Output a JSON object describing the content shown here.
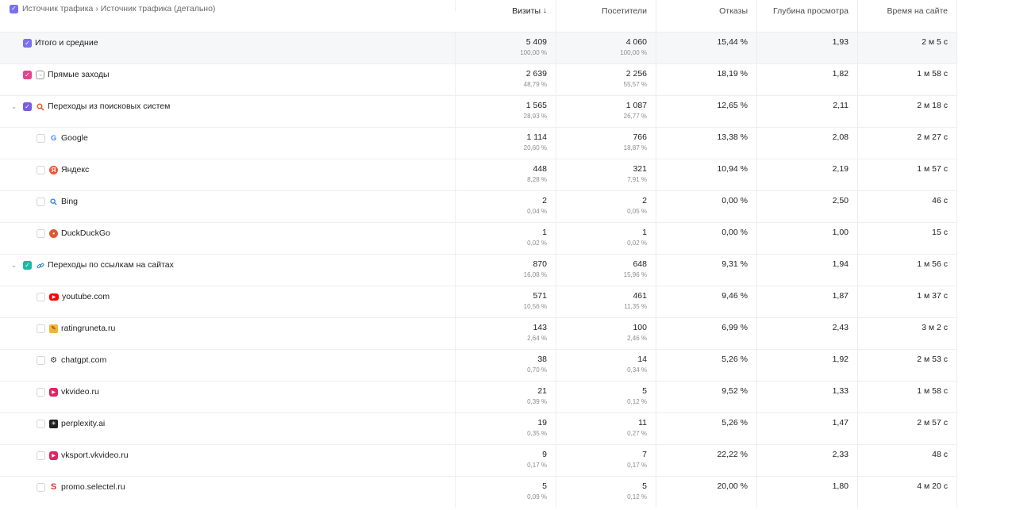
{
  "colors": {
    "purple": "#7a6ff0",
    "pink": "#e8428f",
    "violet": "#7b5ce0",
    "teal": "#1fb8a6"
  },
  "header": {
    "dimension": "Источник трафика › Источник трафика (детально)",
    "visits": "Визиты",
    "sort_icon": "arrow-down-icon",
    "visitors": "Посетители",
    "bounces": "Отказы",
    "depth": "Глубина просмотра",
    "time": "Время на сайте"
  },
  "rows": [
    {
      "label": "Итого и средние",
      "icon": "none",
      "visits": "5 409",
      "visits_pct": "100,00 %",
      "visitors": "4 060",
      "visitors_pct": "100,00 %",
      "bounces": "15,44 %",
      "depth": "1,93",
      "time": "2 м 5 с"
    },
    {
      "label": "Прямые заходы",
      "icon": "direct-entry-icon",
      "visits": "2 639",
      "visits_pct": "48,79 %",
      "visitors": "2 256",
      "visitors_pct": "55,57 %",
      "bounces": "18,19 %",
      "depth": "1,82",
      "time": "1 м 58 с"
    },
    {
      "label": "Переходы из поисковых систем",
      "icon": "search-icon",
      "visits": "1 565",
      "visits_pct": "28,93 %",
      "visitors": "1 087",
      "visitors_pct": "26,77 %",
      "bounces": "12,65 %",
      "depth": "2,11",
      "time": "2 м 18 с"
    },
    {
      "label": "Google",
      "icon": "google-icon",
      "visits": "1 114",
      "visits_pct": "20,60 %",
      "visitors": "766",
      "visitors_pct": "18,87 %",
      "bounces": "13,38 %",
      "depth": "2,08",
      "time": "2 м 27 с"
    },
    {
      "label": "Яндекс",
      "icon": "yandex-icon",
      "visits": "448",
      "visits_pct": "8,28 %",
      "visitors": "321",
      "visitors_pct": "7,91 %",
      "bounces": "10,94 %",
      "depth": "2,19",
      "time": "1 м 57 с"
    },
    {
      "label": "Bing",
      "icon": "bing-search-icon",
      "visits": "2",
      "visits_pct": "0,04 %",
      "visitors": "2",
      "visitors_pct": "0,05 %",
      "bounces": "0,00 %",
      "depth": "2,50",
      "time": "46 с"
    },
    {
      "label": "DuckDuckGo",
      "icon": "duckduckgo-icon",
      "visits": "1",
      "visits_pct": "0,02 %",
      "visitors": "1",
      "visitors_pct": "0,02 %",
      "bounces": "0,00 %",
      "depth": "1,00",
      "time": "15 с"
    },
    {
      "label": "Переходы по ссылкам на сайтах",
      "icon": "link-icon",
      "visits": "870",
      "visits_pct": "16,08 %",
      "visitors": "648",
      "visitors_pct": "15,96 %",
      "bounces": "9,31 %",
      "depth": "1,94",
      "time": "1 м 56 с"
    },
    {
      "label": "youtube.com",
      "icon": "youtube-icon",
      "visits": "571",
      "visits_pct": "10,56 %",
      "visitors": "461",
      "visitors_pct": "11,35 %",
      "bounces": "9,46 %",
      "depth": "1,87",
      "time": "1 м 37 с"
    },
    {
      "label": "ratingruneta.ru",
      "icon": "ratingruneta-icon",
      "visits": "143",
      "visits_pct": "2,64 %",
      "visitors": "100",
      "visitors_pct": "2,46 %",
      "bounces": "6,99 %",
      "depth": "2,43",
      "time": "3 м 2 с"
    },
    {
      "label": "chatgpt.com",
      "icon": "chatgpt-icon",
      "visits": "38",
      "visits_pct": "0,70 %",
      "visitors": "14",
      "visitors_pct": "0,34 %",
      "bounces": "5,26 %",
      "depth": "1,92",
      "time": "2 м 53 с"
    },
    {
      "label": "vkvideo.ru",
      "icon": "vkvideo-icon",
      "visits": "21",
      "visits_pct": "0,39 %",
      "visitors": "5",
      "visitors_pct": "0,12 %",
      "bounces": "9,52 %",
      "depth": "1,33",
      "time": "1 м 58 с"
    },
    {
      "label": "perplexity.ai",
      "icon": "perplexity-icon",
      "visits": "19",
      "visits_pct": "0,35 %",
      "visitors": "11",
      "visitors_pct": "0,27 %",
      "bounces": "5,26 %",
      "depth": "1,47",
      "time": "2 м 57 с"
    },
    {
      "label": "vksport.vkvideo.ru",
      "icon": "vksport-icon",
      "visits": "9",
      "visits_pct": "0,17 %",
      "visitors": "7",
      "visitors_pct": "0,17 %",
      "bounces": "22,22 %",
      "depth": "2,33",
      "time": "48 с"
    },
    {
      "label": "promo.selectel.ru",
      "icon": "selectel-icon",
      "visits": "5",
      "visits_pct": "0,09 %",
      "visitors": "5",
      "visitors_pct": "0,12 %",
      "bounces": "20,00 %",
      "depth": "1,80",
      "time": "4 м 20 с"
    }
  ]
}
